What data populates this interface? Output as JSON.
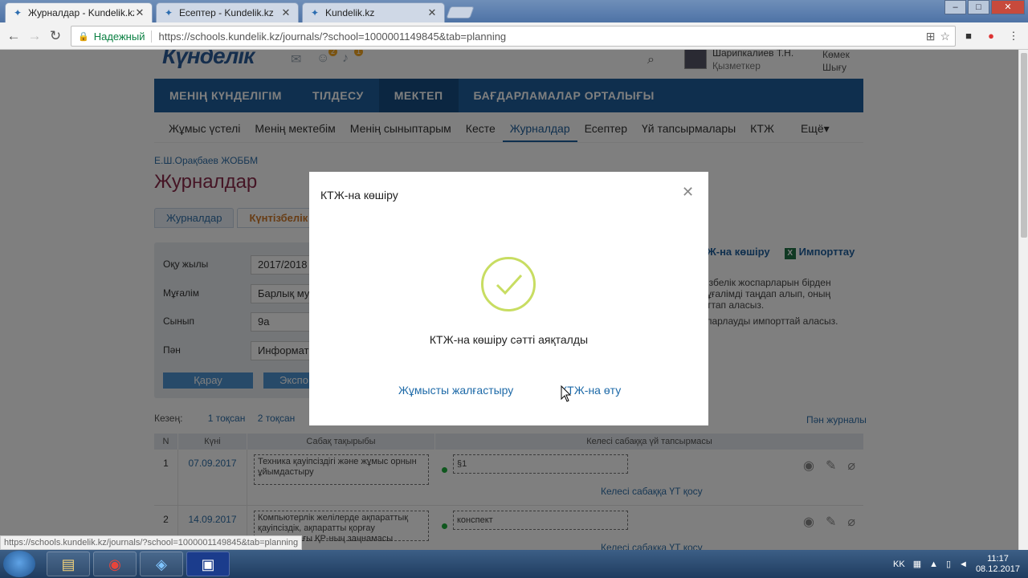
{
  "browser": {
    "tabs": [
      {
        "label": "Журналдар - Kundelik.kz",
        "active": true
      },
      {
        "label": "Есептер - Kundelik.kz",
        "active": false
      },
      {
        "label": "Kundelik.kz",
        "active": false
      }
    ],
    "secure_label": "Надежный",
    "url": "https://schools.kundelik.kz/journals/?school=1000001149845&tab=planning",
    "status_url": "https://schools.kundelik.kz/journals/?school=1000001149845&tab=planning"
  },
  "header": {
    "logo": "Күнделік",
    "badges": {
      "notifications": "2",
      "alerts": "1"
    },
    "user_name": "Шарипкалиев Т.Н.",
    "user_role": "Қызметкер",
    "help": "Көмек",
    "logout": "Шығу"
  },
  "main_nav": [
    "МЕНІҢ КҮНДЕЛІГІМ",
    "ТІЛДЕСУ",
    "МЕКТЕП",
    "БАҒДАРЛАМАЛАР ОРТАЛЫҒЫ"
  ],
  "sub_nav": [
    "Жұмыс үстелі",
    "Менің мектебім",
    "Менің сыныптарым",
    "Кесте",
    "Журналдар",
    "Есептер",
    "Үй тапсырмалары",
    "КТЖ",
    "Ещё"
  ],
  "breadcrumb": "Е.Ш.Орақбаев ЖОББМ",
  "page_title": "Журналдар",
  "page_tabs": [
    "Журналдар",
    "Күнтізбелік ж"
  ],
  "filters": {
    "year_label": "Оқу жылы",
    "year_value": "2017/2018",
    "teacher_label": "Мұғалім",
    "teacher_value": "Барлық му",
    "class_label": "Сынып",
    "class_value": "9а",
    "subject_label": "Пән",
    "subject_value": "Информат",
    "view_btn": "Қарау",
    "export_btn": "Экспо"
  },
  "right_actions": {
    "copy": "Ж-на көшіру",
    "import": "Импорттау",
    "info1": "ізбелік жоспарларын бірден ұғалімді таңдап алып, оның ттап аласыз.",
    "info2": "парлауды импорттай аласыз."
  },
  "periods": {
    "label": "Кезең:",
    "p1": "1 тоқсан",
    "p2": "2 тоқсан",
    "subject_journal": "Пән журналы"
  },
  "table": {
    "headers": [
      "N",
      "Күні",
      "Сабақ тақырыбы",
      "Келесі сабаққа үй тапсырмасы"
    ],
    "rows": [
      {
        "n": "1",
        "date": "07.09.2017",
        "topic": "Техника қауіпсіздігі және жұмыс орнын ұйымдастыру",
        "hw": "§1",
        "add": "Келесі сабаққа ҮТ қосу"
      },
      {
        "n": "2",
        "date": "14.09.2017",
        "topic": "Компьютерлік желілерде ақпараттық қауіпсіздік, ақпаратты қорғау саласындағы ҚР-ның заңнамасы",
        "hw": "конспект",
        "add": "Келесі сабаққа ҮТ қосу"
      }
    ]
  },
  "modal": {
    "title": "КТЖ-на көшіру",
    "message": "КТЖ-на көшіру сәтті аяқталды",
    "continue": "Жұмысты жалғастыру",
    "goto": "КТЖ-на өту"
  },
  "taskbar": {
    "lang": "KK",
    "time": "11:17",
    "date": "08.12.2017"
  },
  "colors": {
    "nav": "#1e5f9c",
    "title": "#8a2a4a",
    "check": "#c8dd62",
    "link": "#1e6aa8"
  }
}
